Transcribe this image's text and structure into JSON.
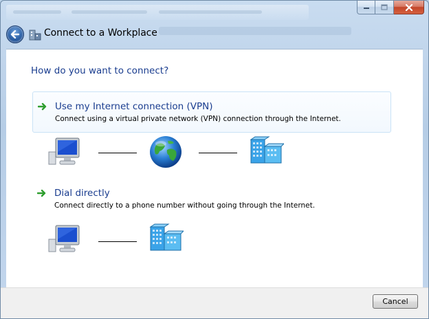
{
  "window": {
    "title": "Connect to a Workplace",
    "buttons": {
      "minimize": "minimize-icon",
      "maximize": "maximize-icon",
      "close": "close-icon"
    }
  },
  "navigation": {
    "back_icon": "back-arrow-icon"
  },
  "main": {
    "question": "How do you want to connect?",
    "options": [
      {
        "title": "Use my Internet connection (VPN)",
        "description": "Connect using a virtual private network (VPN) connection through the Internet.",
        "icon": "green-arrow-icon",
        "diagram": [
          "computer-icon",
          "globe-icon",
          "server-icon"
        ]
      },
      {
        "title": "Dial directly",
        "description": "Connect directly to a phone number without going through the Internet.",
        "icon": "green-arrow-icon",
        "diagram": [
          "computer-icon",
          "server-icon"
        ]
      }
    ]
  },
  "footer": {
    "cancel_label": "Cancel"
  },
  "colors": {
    "link_blue": "#1a3d8f",
    "accent_green": "#2f9e2f",
    "frame_blue": "#bcd3ea"
  }
}
